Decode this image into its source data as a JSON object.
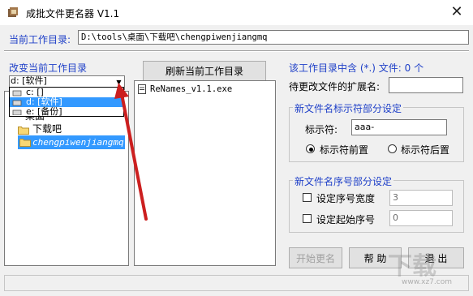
{
  "window": {
    "title": "成批文件更名器 V1.1",
    "close_glyph": "✕"
  },
  "path_row": {
    "label": "当前工作目录:",
    "value": "D:\\tools\\桌面\\下载吧\\chengpiwenjiangmq"
  },
  "left_panel": {
    "change_dir_label": "改变当前工作目录",
    "drive_combo_value": "d: [软件]",
    "dropdown_options": [
      "c: []",
      "d: [软件]",
      "e: [备份]"
    ],
    "dropdown_selected_index": 1,
    "tree_items": [
      "下载吧",
      "chengpiwenjiangmq"
    ],
    "tree_partial": "桌面"
  },
  "middle_panel": {
    "refresh_button": "刷新当前工作目录",
    "files": [
      "ReNames_v1.1.exe"
    ]
  },
  "right_panel": {
    "file_count_label": "该工作目录中含 (*.) 文件: 0 个",
    "ext_label": "待更改文件的扩展名:",
    "ext_value": "",
    "prefix_group_title": "新文件名标示符部分设定",
    "prefix_label": "标示符:",
    "prefix_value": "aaa-",
    "radio_front": "标示符前置",
    "radio_back": "标示符后置",
    "radio_selected": "front",
    "seq_group_title": "新文件名序号部分设定",
    "seq_width_label": "设定序号宽度",
    "seq_width_value": "3",
    "seq_start_label": "设定起始序号",
    "seq_start_value": "0",
    "start_button": "开始更名",
    "help_button": "帮  助",
    "exit_button": "退  出"
  },
  "watermark": "www.xz7.com",
  "colors": {
    "accent_label": "#1f40c8",
    "selection": "#3399ff",
    "arrow": "#cc1f1f"
  }
}
